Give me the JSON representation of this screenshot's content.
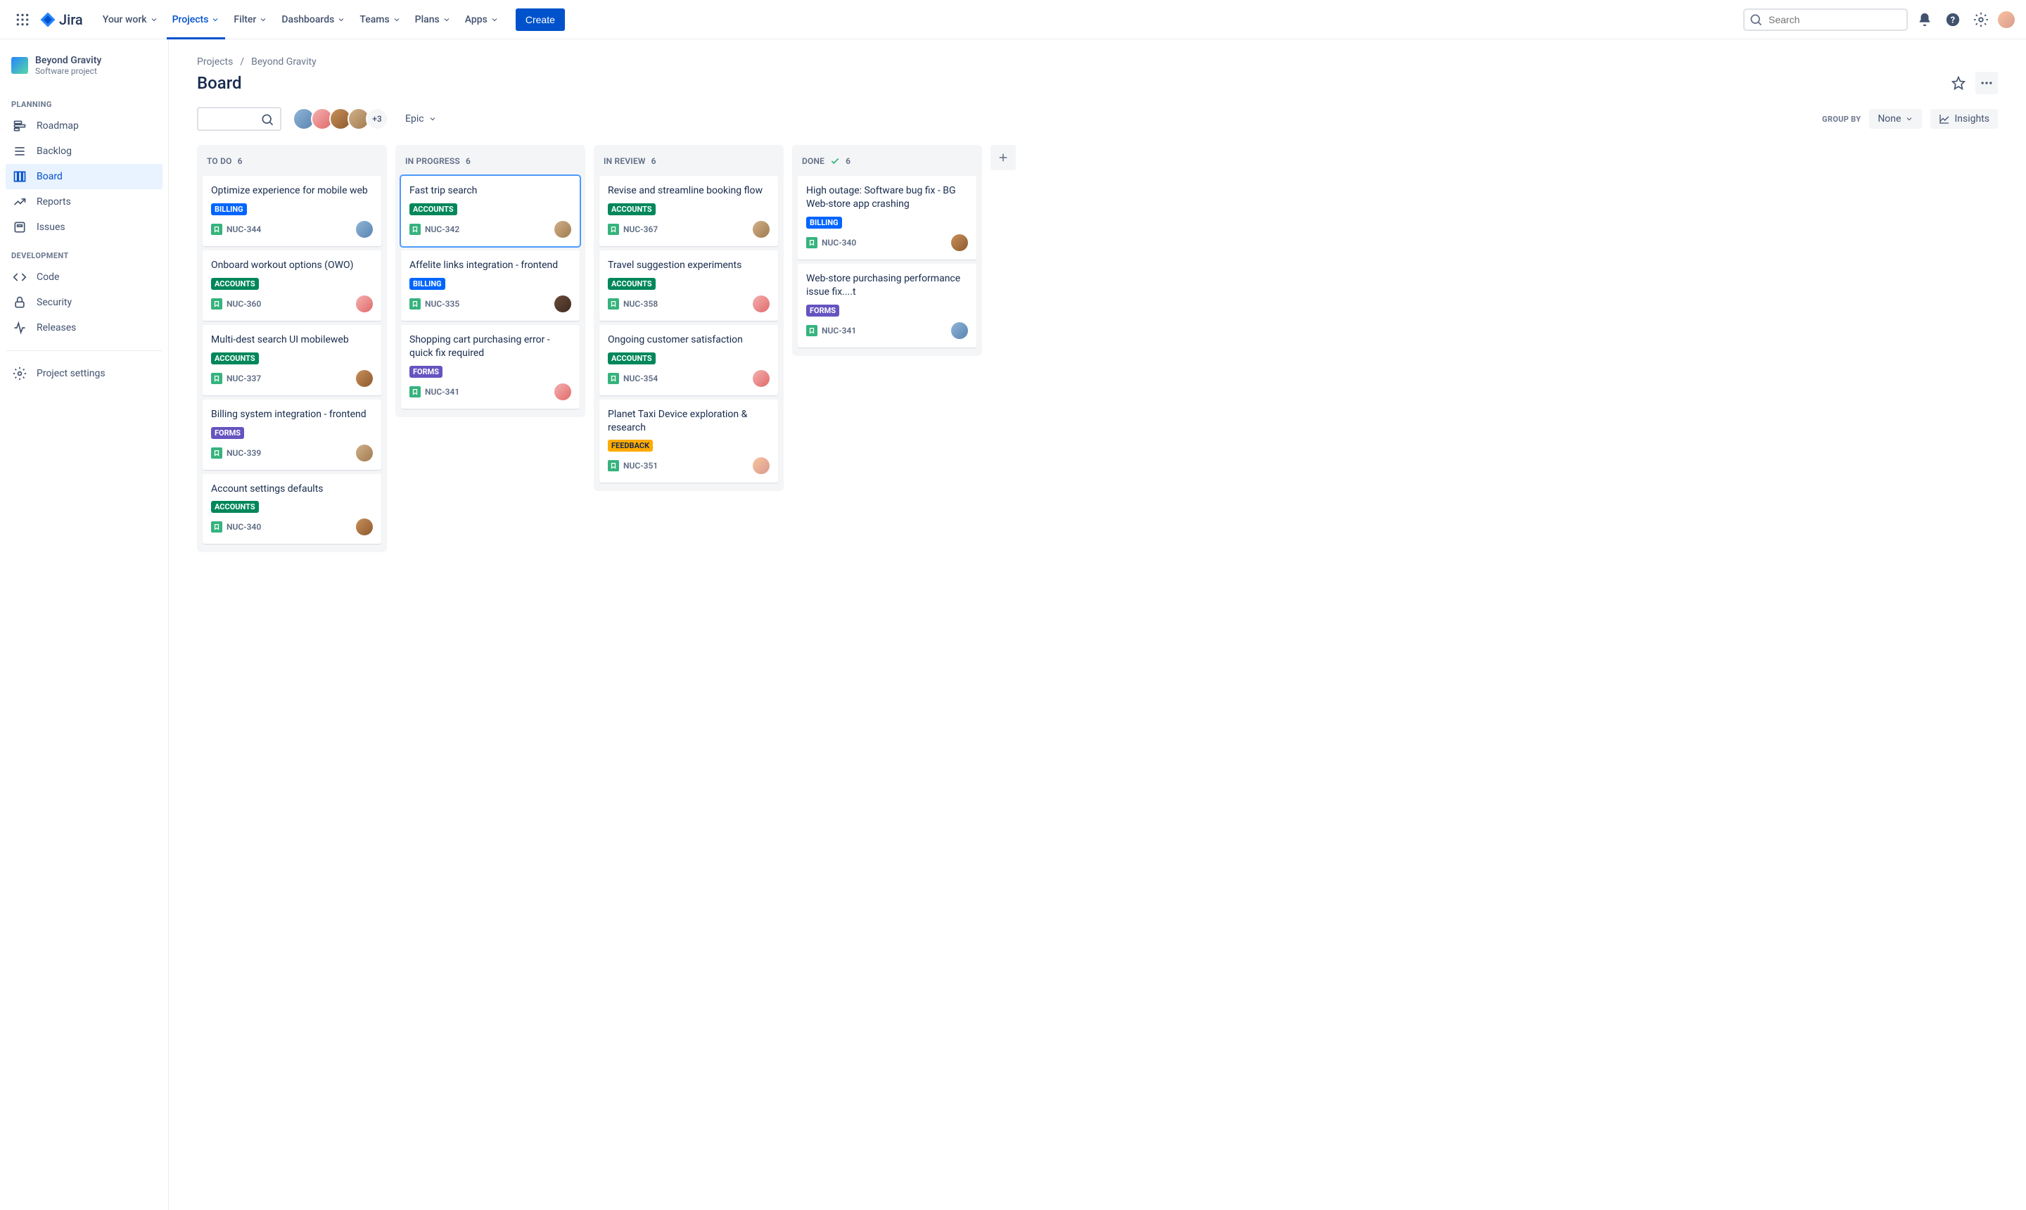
{
  "nav": {
    "logo": "Jira",
    "items": [
      "Your work",
      "Projects",
      "Filter",
      "Dashboards",
      "Teams",
      "Plans",
      "Apps"
    ],
    "active_index": 1,
    "create": "Create",
    "search_placeholder": "Search"
  },
  "sidebar": {
    "project_name": "Beyond Gravity",
    "project_type": "Software project",
    "groups": [
      {
        "label": "PLANNING",
        "items": [
          {
            "icon": "roadmap",
            "label": "Roadmap"
          },
          {
            "icon": "backlog",
            "label": "Backlog"
          },
          {
            "icon": "board",
            "label": "Board",
            "active": true
          },
          {
            "icon": "reports",
            "label": "Reports"
          },
          {
            "icon": "issues",
            "label": "Issues"
          }
        ]
      },
      {
        "label": "DEVELOPMENT",
        "items": [
          {
            "icon": "code",
            "label": "Code"
          },
          {
            "icon": "security",
            "label": "Security"
          },
          {
            "icon": "releases",
            "label": "Releases"
          }
        ]
      }
    ],
    "settings": "Project settings"
  },
  "breadcrumb": [
    "Projects",
    "Beyond Gravity"
  ],
  "page_title": "Board",
  "toolbar": {
    "avatars_more": "+3",
    "epic_label": "Epic",
    "groupby_label": "GROUP BY",
    "groupby_value": "None",
    "insights": "Insights"
  },
  "columns": [
    {
      "name": "TO DO",
      "count": "6",
      "done": false,
      "cards": [
        {
          "title": "Optimize experience for mobile web",
          "tag": "BILLING",
          "key": "NUC-344",
          "avatar": "c4"
        },
        {
          "title": "Onboard workout options (OWO)",
          "tag": "ACCOUNTS",
          "key": "NUC-360",
          "avatar": "c1"
        },
        {
          "title": "Multi-dest search UI mobileweb",
          "tag": "ACCOUNTS",
          "key": "NUC-337",
          "avatar": "c2"
        },
        {
          "title": "Billing system integration - frontend",
          "tag": "FORMS",
          "key": "NUC-339",
          "avatar": "c3"
        },
        {
          "title": "Account settings defaults",
          "tag": "ACCOUNTS",
          "key": "NUC-340",
          "avatar": "c2"
        }
      ]
    },
    {
      "name": "IN PROGRESS",
      "count": "6",
      "done": false,
      "cards": [
        {
          "title": "Fast trip search",
          "tag": "ACCOUNTS",
          "key": "NUC-342",
          "avatar": "c3",
          "selected": true
        },
        {
          "title": "Affelite links integration - frontend",
          "tag": "BILLING",
          "key": "NUC-335",
          "avatar": "c5"
        },
        {
          "title": "Shopping cart purchasing error - quick fix required",
          "tag": "FORMS",
          "key": "NUC-341",
          "avatar": "c1"
        }
      ]
    },
    {
      "name": "IN REVIEW",
      "count": "6",
      "done": false,
      "cards": [
        {
          "title": "Revise and streamline booking flow",
          "tag": "ACCOUNTS",
          "key": "NUC-367",
          "avatar": "c3"
        },
        {
          "title": "Travel suggestion experiments",
          "tag": "ACCOUNTS",
          "key": "NUC-358",
          "avatar": "c1"
        },
        {
          "title": "Ongoing customer satisfaction",
          "tag": "ACCOUNTS",
          "key": "NUC-354",
          "avatar": "c1"
        },
        {
          "title": "Planet Taxi Device exploration & research",
          "tag": "FEEDBACK",
          "key": "NUC-351",
          "avatar": "c0"
        }
      ]
    },
    {
      "name": "DONE",
      "count": "6",
      "done": true,
      "cards": [
        {
          "title": "High outage: Software bug fix - BG Web-store app crashing",
          "tag": "BILLING",
          "key": "NUC-340",
          "avatar": "c2"
        },
        {
          "title": "Web-store purchasing performance issue fix....t",
          "tag": "FORMS",
          "key": "NUC-341",
          "avatar": "c4"
        }
      ]
    }
  ]
}
